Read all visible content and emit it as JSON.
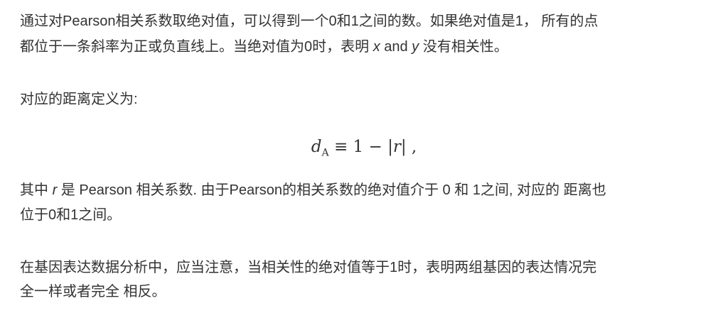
{
  "paragraphs": {
    "p1": {
      "line1": "通过对Pearson相关系数取绝对值，可以得到一个0和1之间的数。如果绝对值是1， 所有的点",
      "line2_a": "都位于一条斜率为正或负直线上。当绝对值为0时，表明 ",
      "line2_x": "x",
      "line2_and": " and ",
      "line2_y": "y",
      "line2_b": " 没有相关性。"
    },
    "p2": {
      "line1": "对应的距离定义为:"
    },
    "formula": {
      "d": "d",
      "sub": "A",
      "rest": " ≡ 1 − |",
      "r": "r",
      "end": "| ,"
    },
    "p3": {
      "line1_a": "其中 ",
      "line1_r": "r",
      "line1_b": " 是 Pearson 相关系数. 由于Pearson的相关系数的绝对值介于 0 和 1之间, 对应的 距离也",
      "line2": "位于0和1之间。"
    },
    "p4": {
      "line1": "在基因表达数据分析中，应当注意，当相关性的绝对值等于1时，表明两组基因的表达情况完",
      "line2": "全一样或者完全 相反。"
    }
  }
}
